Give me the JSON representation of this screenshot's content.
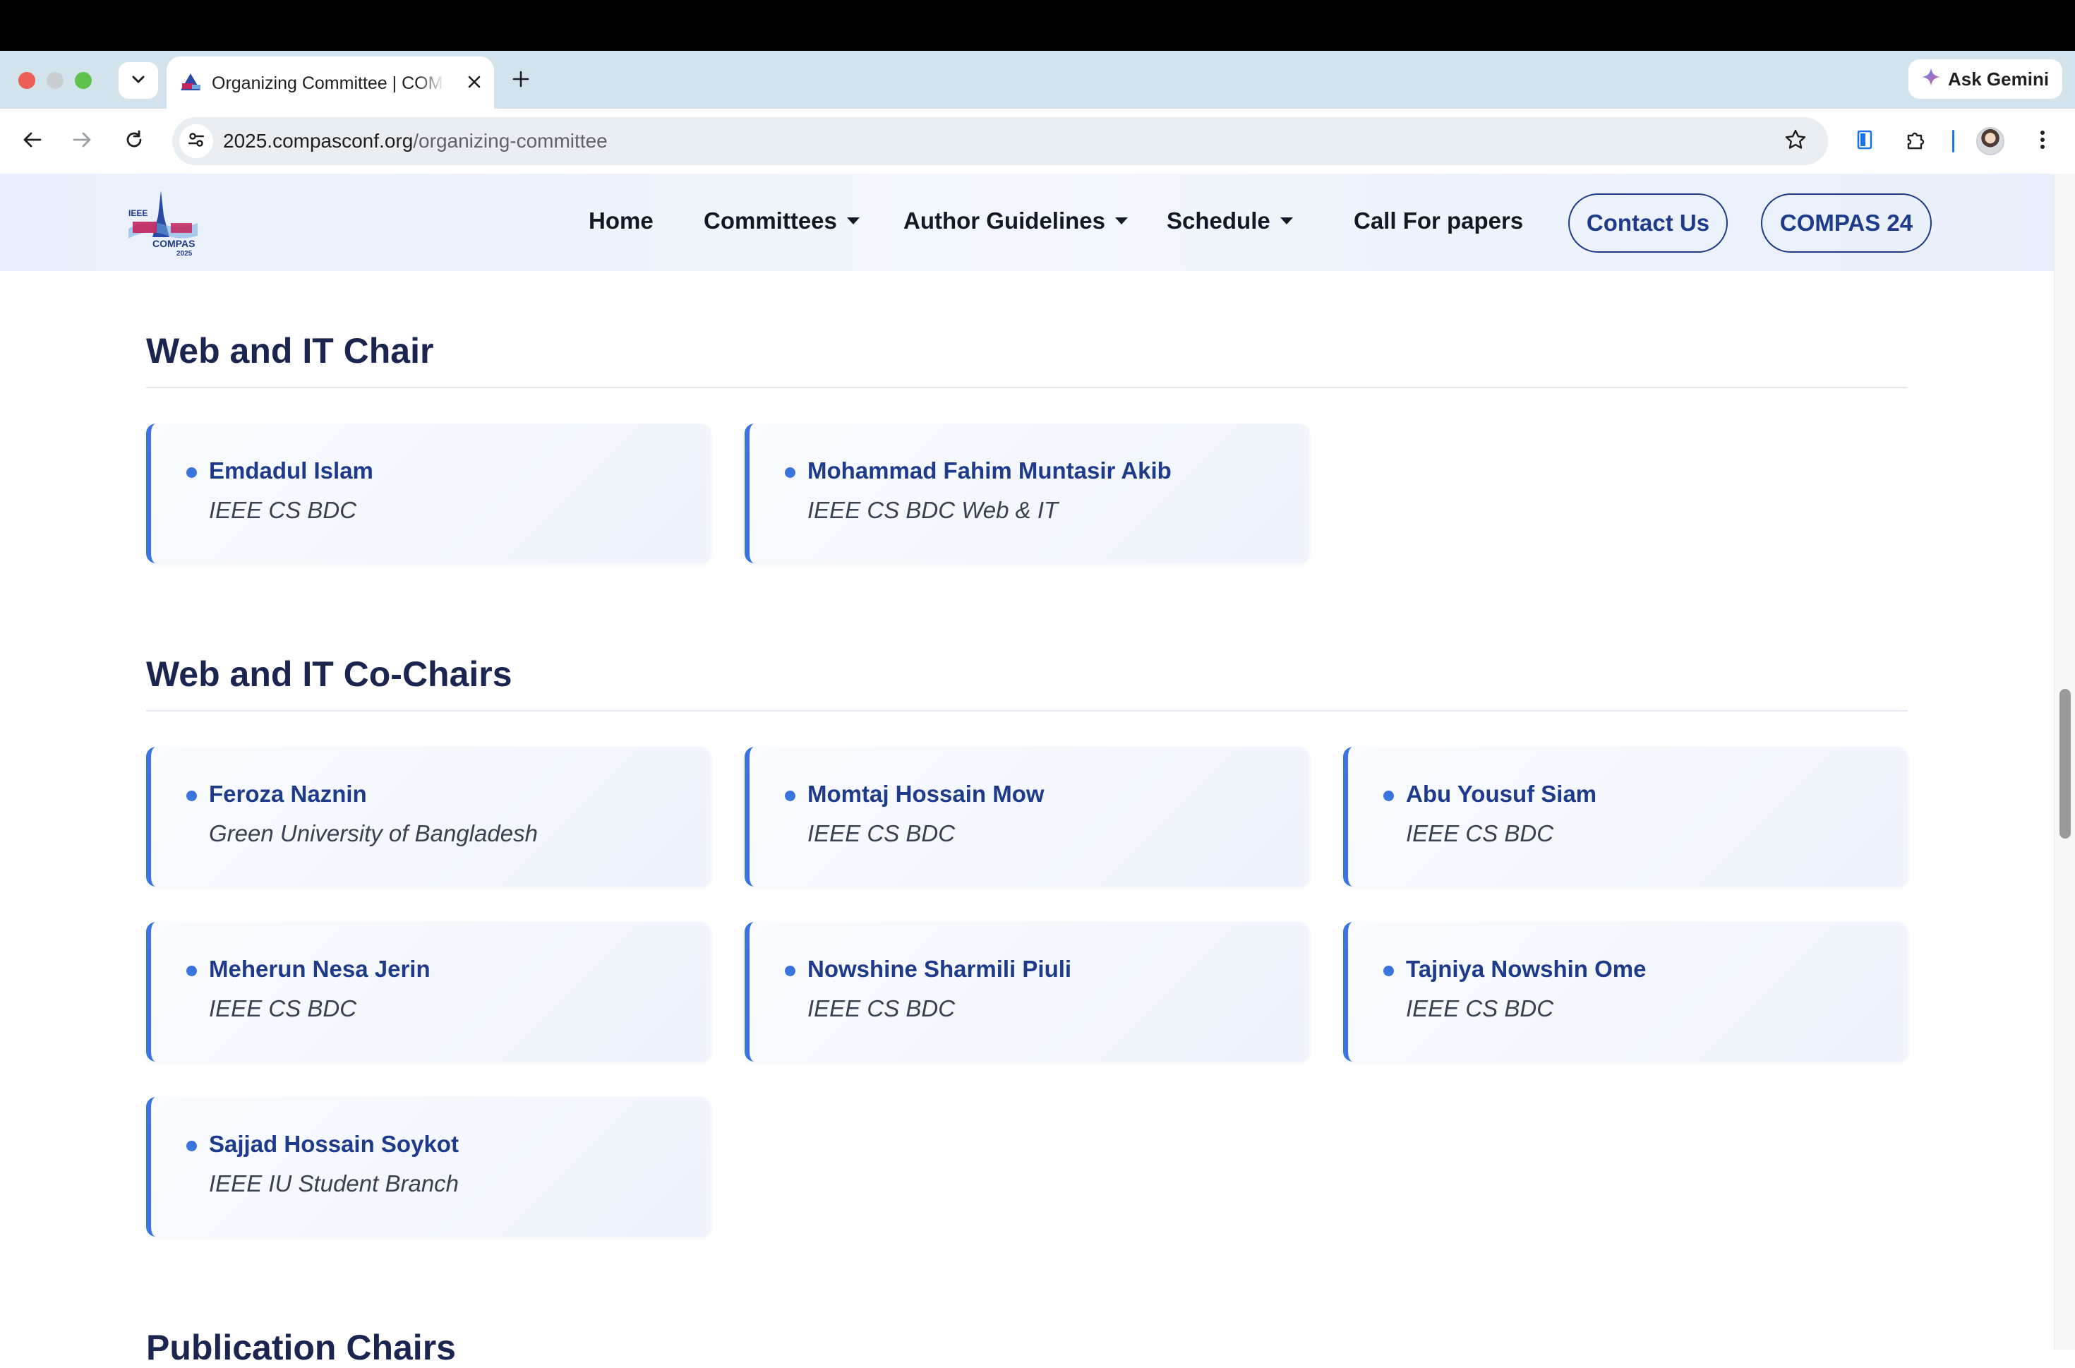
{
  "browser": {
    "tab_title": "Organizing Committee | COMPAS 2025",
    "ask_gemini_label": "Ask Gemini",
    "url_domain": "2025.compasconf.org",
    "url_path": "/organizing-committee"
  },
  "site": {
    "logo_text": [
      "IEEE",
      "COMPAS",
      "2025"
    ],
    "nav": {
      "home": "Home",
      "committees": "Committees",
      "author_guidelines": "Author Guidelines",
      "schedule": "Schedule",
      "call_for_papers": "Call For papers",
      "contact_us": "Contact Us",
      "compas24": "COMPAS 24"
    }
  },
  "sections": [
    {
      "title": "Web and IT Chair",
      "members": [
        {
          "name": "Emdadul Islam",
          "affiliation": "IEEE CS BDC"
        },
        {
          "name": "Mohammad Fahim Muntasir Akib",
          "affiliation": "IEEE CS BDC Web & IT"
        }
      ]
    },
    {
      "title": "Web and IT Co-Chairs",
      "members": [
        {
          "name": "Feroza Naznin",
          "affiliation": "Green University of Bangladesh"
        },
        {
          "name": "Momtaj Hossain Mow",
          "affiliation": "IEEE CS BDC"
        },
        {
          "name": "Abu Yousuf Siam",
          "affiliation": "IEEE CS BDC"
        },
        {
          "name": "Meherun Nesa Jerin",
          "affiliation": "IEEE CS BDC"
        },
        {
          "name": "Nowshine Sharmili Piuli",
          "affiliation": "IEEE CS BDC"
        },
        {
          "name": "Tajniya Nowshin Ome",
          "affiliation": "IEEE CS BDC"
        },
        {
          "name": "Sajjad Hossain Soykot",
          "affiliation": "IEEE IU Student Branch"
        }
      ]
    },
    {
      "title": "Publication Chairs",
      "members": []
    }
  ]
}
